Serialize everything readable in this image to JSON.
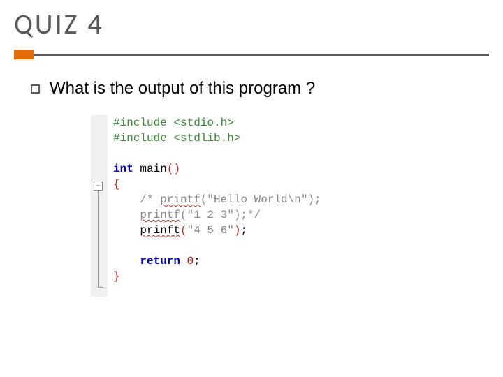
{
  "title": "QUIZ 4",
  "question": "What is the output of this program ?",
  "code": {
    "inc1_a": "#include",
    "inc1_b": " <stdio.h>",
    "inc2_a": "#include",
    "inc2_b": " <stdlib.h>",
    "kw_int": "int",
    "fn_main": " main",
    "paren_open": "(",
    "paren_close": ")",
    "brace_open": "{",
    "cm1_a": "    /* ",
    "cm1_printf": "printf",
    "cm1_b": "(\"Hello World\\n\");",
    "cm2_a": "    ",
    "cm2_printf": "printf",
    "cm2_b": "(\"1 2 3\");*/",
    "call_indent": "    ",
    "call_fn": "prinft",
    "call_p_open": "(",
    "call_str": "\"4 5 6\"",
    "call_p_close": ")",
    "call_semi": ";",
    "ret_indent": "    ",
    "kw_return": "return",
    "ret_val": " 0",
    "ret_semi": ";",
    "brace_close": "}"
  },
  "fold_symbol": "−"
}
